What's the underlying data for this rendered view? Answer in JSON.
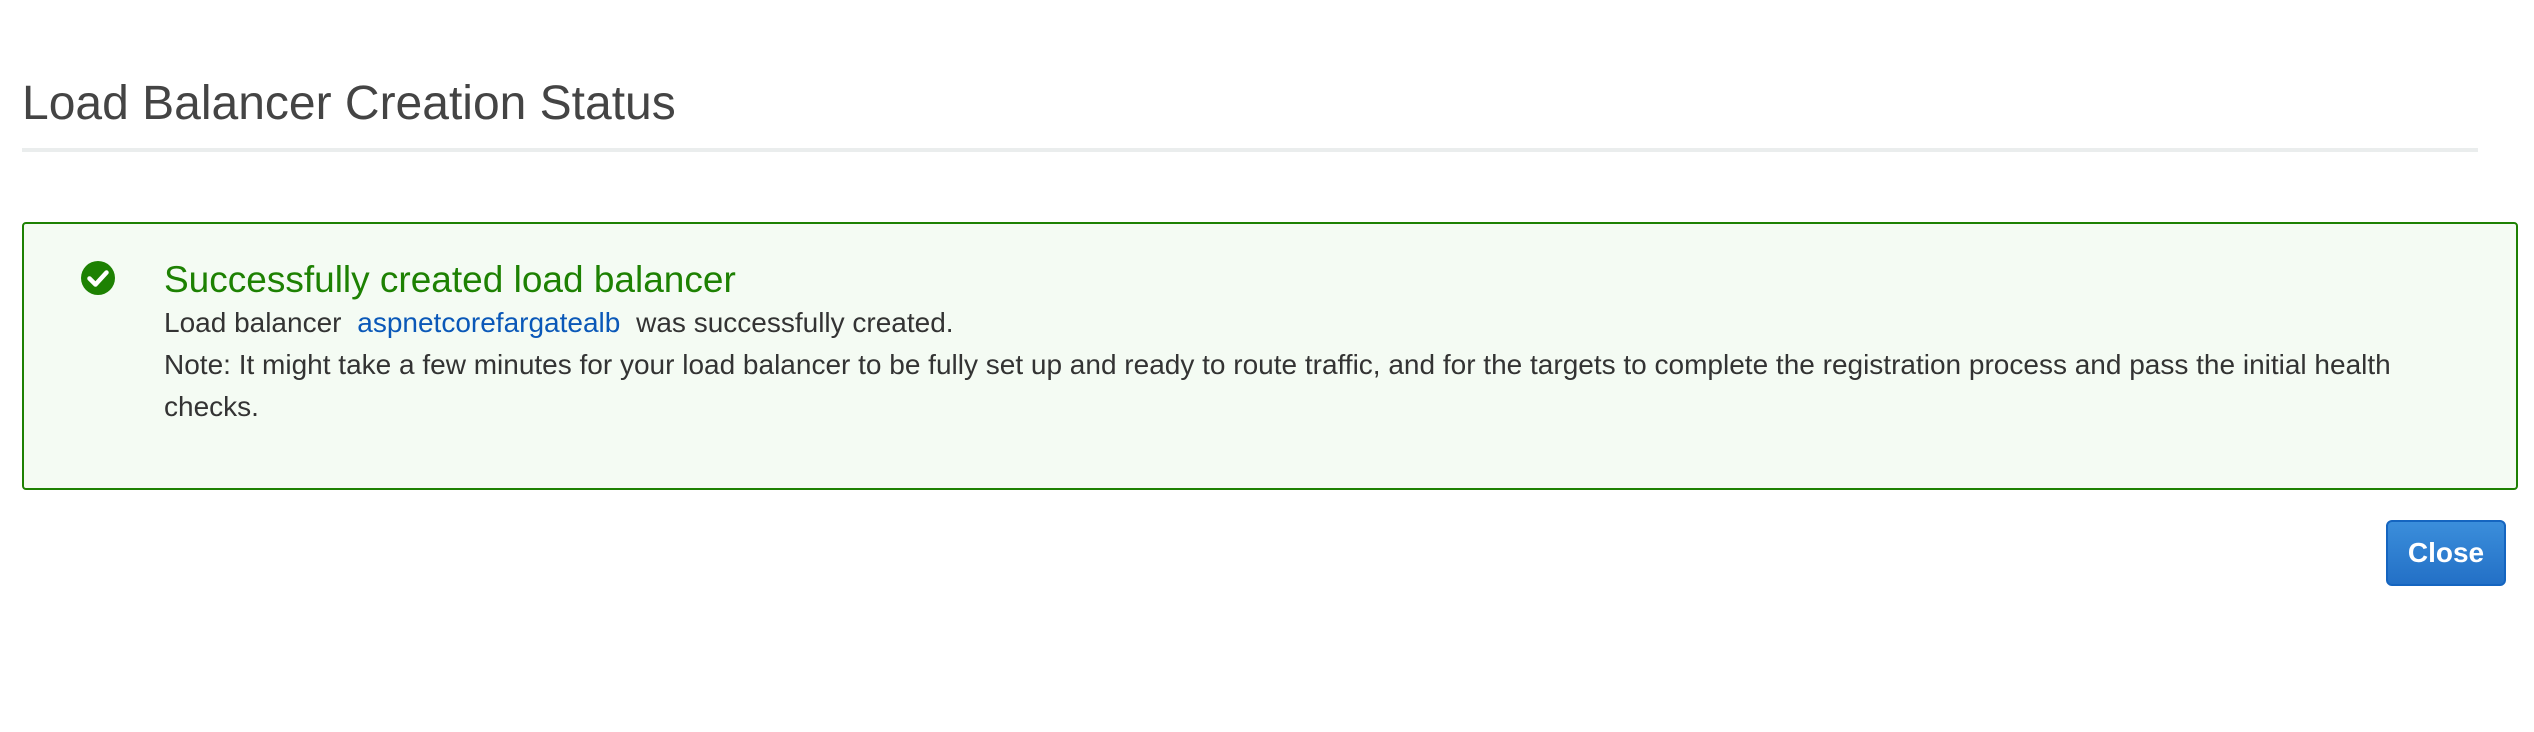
{
  "header": {
    "title": "Load Balancer Creation Status"
  },
  "alert": {
    "icon": "check-circle-icon",
    "color": "#1d8102",
    "title": "Successfully created load balancer",
    "message_prefix": "Load balancer",
    "load_balancer_name": "aspnetcorefargatealb",
    "message_suffix": "was successfully created.",
    "note": "Note: It might take a few minutes for your load balancer to be fully set up and ready to route traffic, and for the targets to complete the registration process and pass the initial health checks."
  },
  "footer": {
    "close_label": "Close",
    "accent_color": "#2370c6"
  }
}
